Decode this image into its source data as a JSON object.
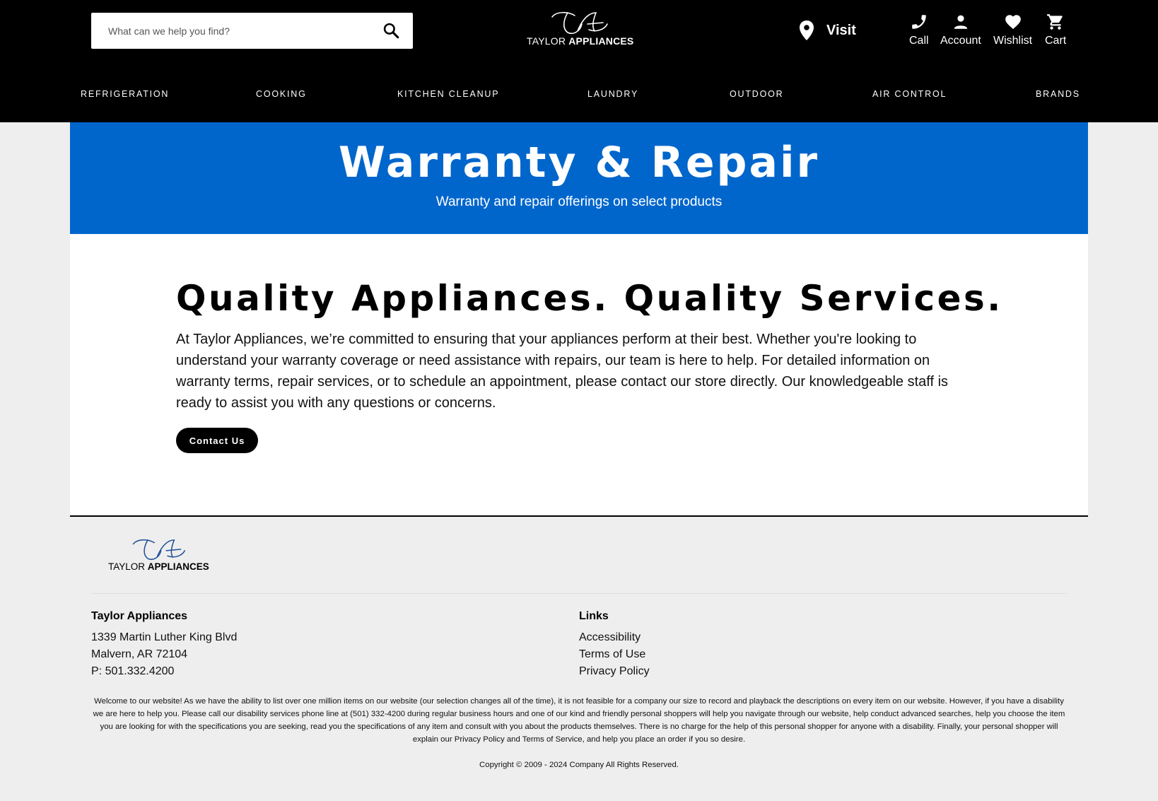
{
  "header": {
    "search": {
      "placeholder": "What can we help you find?"
    },
    "logo": {
      "brand_regular": "TAYLOR",
      "brand_bold": "APPLIANCES"
    },
    "visit_label": "Visit",
    "utilities": [
      {
        "label": "Call",
        "icon": "phone-icon"
      },
      {
        "label": "Account",
        "icon": "person-icon"
      },
      {
        "label": "Wishlist",
        "icon": "heart-icon"
      },
      {
        "label": "Cart",
        "icon": "cart-icon"
      }
    ],
    "nav": [
      "REFRIGERATION",
      "COOKING",
      "KITCHEN CLEANUP",
      "LAUNDRY",
      "OUTDOOR",
      "AIR CONTROL",
      "BRANDS"
    ]
  },
  "hero": {
    "title": "Warranty & Repair",
    "subtitle": "Warranty and repair offerings on select products"
  },
  "main": {
    "heading": "Quality Appliances. Quality Services.",
    "body": "At Taylor Appliances, we’re committed to ensuring that your appliances perform at their best. Whether you're looking to understand your warranty coverage or need assistance with repairs, our team is here to help. For detailed information on warranty terms, repair services, or to schedule an appointment, please contact our store directly. Our knowledgeable staff is ready to assist you with any questions or concerns.",
    "cta_label": "Contact Us"
  },
  "footer": {
    "logo": {
      "brand_regular": "TAYLOR",
      "brand_bold": "APPLIANCES"
    },
    "store": {
      "heading": "Taylor Appliances",
      "address1": "1339 Martin Luther King Blvd",
      "address2": "Malvern, AR 72104",
      "phone": "P: 501.332.4200"
    },
    "links": {
      "heading": "Links",
      "items": [
        "Accessibility",
        "Terms of Use",
        "Privacy Policy"
      ]
    },
    "disclaimer": "Welcome to our website! As we have the ability to list over one million items on our website (our selection changes all of the time), it is not feasible for a company our size to record and playback the descriptions on every item on our website. However, if you have a disability we are here to help you. Please call our disability services phone line at (501) 332-4200 during regular business hours and one of our kind and friendly personal shoppers will help you navigate through our website, help conduct advanced searches, help you choose the item you are looking for with the specifications you are seeking, read you the specifications of any item and consult with you about the products themselves. There is no charge for the help of this personal shopper for anyone with a disability. Finally, your personal shopper will explain our Privacy Policy and Terms of Service, and help you place an order if you so desire.",
    "copyright": "Copyright © 2009 - 2024 Company All Rights Reserved."
  },
  "colors": {
    "header_bg": "#000000",
    "hero_bg": "#0066cc",
    "page_bg": "#eeeeee",
    "content_bg": "#ffffff",
    "button_bg": "#000000"
  }
}
